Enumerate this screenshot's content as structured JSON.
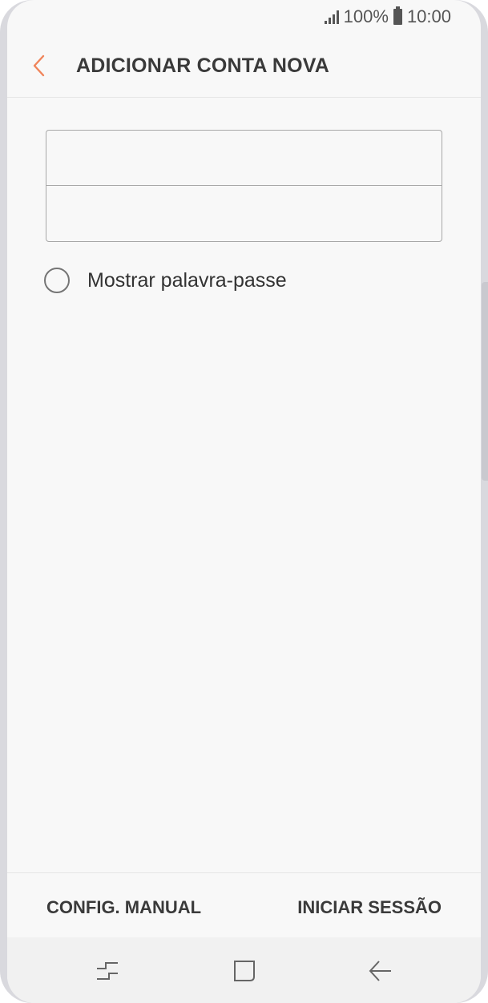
{
  "status_bar": {
    "battery_percent": "100%",
    "time": "10:00",
    "icons": [
      "signal-icon",
      "battery-icon"
    ]
  },
  "header": {
    "title": "ADICIONAR CONTA NOVA",
    "back_icon": "chevron-left-icon",
    "accent_color": "#f0845a"
  },
  "form": {
    "email": {
      "value": "",
      "placeholder": ""
    },
    "password": {
      "value": "",
      "placeholder": ""
    },
    "show_password": {
      "label": "Mostrar palavra-passe",
      "checked": false
    }
  },
  "actions": {
    "manual_setup": "CONFIG. MANUAL",
    "sign_in": "INICIAR SESSÃO"
  },
  "nav_bar": {
    "icons": [
      "recent-apps-icon",
      "home-icon",
      "back-arrow-icon"
    ]
  }
}
